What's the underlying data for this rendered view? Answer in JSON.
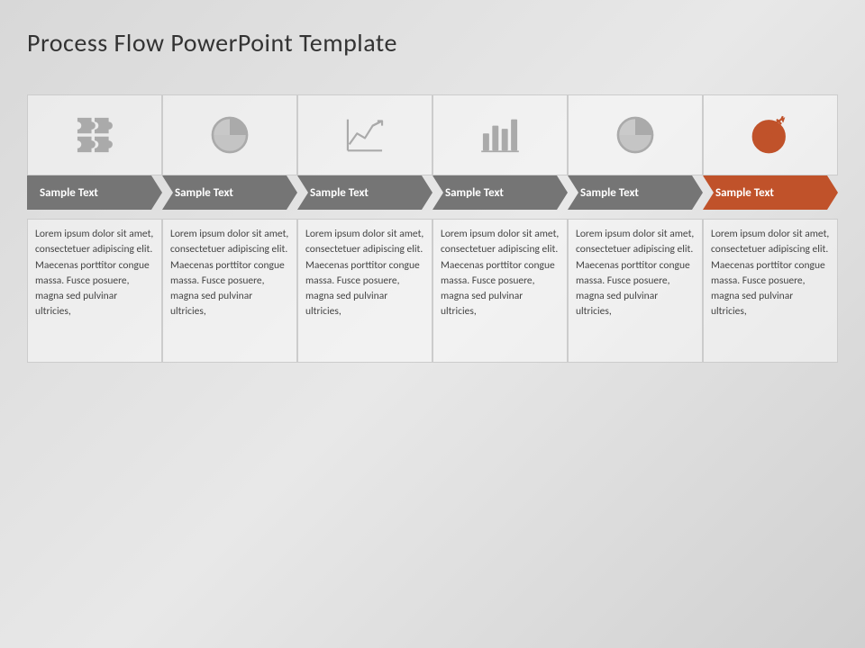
{
  "title": "Process Flow PowerPoint Template",
  "steps": [
    {
      "id": 1,
      "label": "Sample Text",
      "icon": "puzzle",
      "accent": false,
      "body": "Lorem ipsum dolor sit amet, consectetuer adipiscing elit. Maecenas porttitor congue massa. Fusce posuere, magna sed pulvinar ultricies,"
    },
    {
      "id": 2,
      "label": "Sample Text",
      "icon": "pie",
      "accent": false,
      "body": "Lorem ipsum dolor sit amet, consectetuer adipiscing elit. Maecenas porttitor congue massa. Fusce posuere, magna sed pulvinar ultricies,"
    },
    {
      "id": 3,
      "label": "Sample Text",
      "icon": "linechart",
      "accent": false,
      "body": "Lorem ipsum dolor sit amet, consectetuer adipiscing elit. Maecenas porttitor congue massa. Fusce posuere, magna sed pulvinar ultricies,"
    },
    {
      "id": 4,
      "label": "Sample Text",
      "icon": "barchart",
      "accent": false,
      "body": "Lorem ipsum dolor sit amet, consectetuer adipiscing elit. Maecenas porttitor congue massa. Fusce posuere, magna sed pulvinar ultricies,"
    },
    {
      "id": 5,
      "label": "Sample Text",
      "icon": "pie2",
      "accent": false,
      "body": "Lorem ipsum dolor sit amet, consectetuer adipiscing elit. Maecenas porttitor congue massa. Fusce posuere, magna sed pulvinar ultricies,"
    },
    {
      "id": 6,
      "label": "Sample Text",
      "icon": "target",
      "accent": true,
      "body": "Lorem ipsum dolor sit amet, consectetuer adipiscing elit. Maecenas porttitor congue massa. Fusce posuere, magna sed pulvinar ultricies,"
    }
  ]
}
